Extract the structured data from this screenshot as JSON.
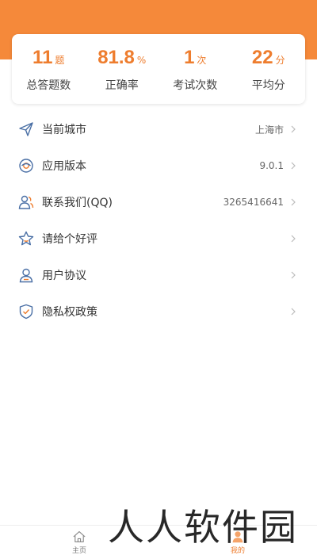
{
  "colors": {
    "accent": "#f5893a",
    "stat_value": "#ee7d2e",
    "icon_stroke": "#4a6fa5",
    "chevron": "#bbbbbb"
  },
  "stats": [
    {
      "value": "11",
      "unit": "题",
      "label": "总答题数"
    },
    {
      "value": "81.8",
      "unit": "%",
      "label": "正确率"
    },
    {
      "value": "1",
      "unit": "次",
      "label": "考试次数"
    },
    {
      "value": "22",
      "unit": "分",
      "label": "平均分"
    }
  ],
  "menu": [
    {
      "icon": "send-icon",
      "label": "当前城市",
      "value": "上海市"
    },
    {
      "icon": "version-icon",
      "label": "应用版本",
      "value": "9.0.1"
    },
    {
      "icon": "contacts-icon",
      "label": "联系我们(QQ)",
      "value": "3265416641"
    },
    {
      "icon": "star-icon",
      "label": "请给个好评",
      "value": ""
    },
    {
      "icon": "user-icon",
      "label": "用户协议",
      "value": ""
    },
    {
      "icon": "shield-check-icon",
      "label": "隐私权政策",
      "value": ""
    }
  ],
  "tabbar": {
    "home_label": "主页",
    "mine_label": "我的"
  },
  "watermark": "人人软件园"
}
